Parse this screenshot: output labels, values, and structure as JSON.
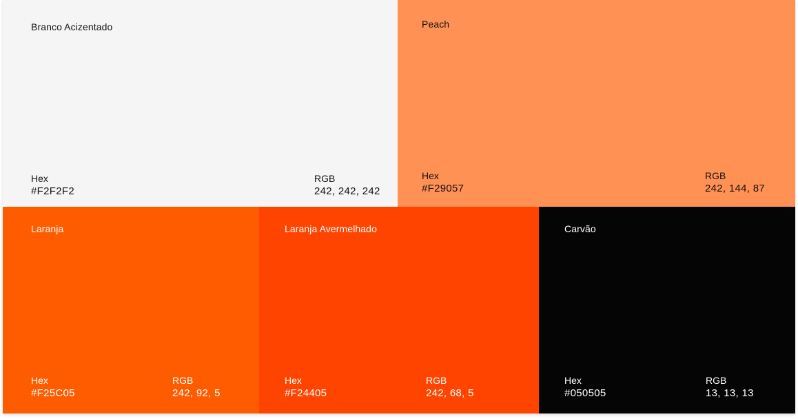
{
  "swatches": [
    {
      "name": "Branco Acizentado",
      "hex_label": "Hex",
      "hex": "#F2F2F2",
      "rgb_label": "RGB",
      "rgb": "242, 242, 242",
      "fill": "#F5F5F5",
      "text_color": "#111111"
    },
    {
      "name": "Peach",
      "hex_label": "Hex",
      "hex": "#F29057",
      "rgb_label": "RGB",
      "rgb": "242, 144, 87",
      "fill": "#FF9155",
      "text_color": "#111111"
    },
    {
      "name": "Laranja",
      "hex_label": "Hex",
      "hex": "#F25C05",
      "rgb_label": "RGB",
      "rgb": "242, 92, 5",
      "fill": "#FF5C00",
      "text_color": "#FFFFFF"
    },
    {
      "name": "Laranja Avermelhado",
      "hex_label": "Hex",
      "hex": "#F24405",
      "rgb_label": "RGB",
      "rgb": "242, 68, 5",
      "fill": "#FF4400",
      "text_color": "#FFFFFF"
    },
    {
      "name": "Carvão",
      "hex_label": "Hex",
      "hex": "#050505",
      "rgb_label": "RGB",
      "rgb": "13, 13, 13",
      "fill": "#050505",
      "text_color": "#FFFFFF"
    }
  ]
}
